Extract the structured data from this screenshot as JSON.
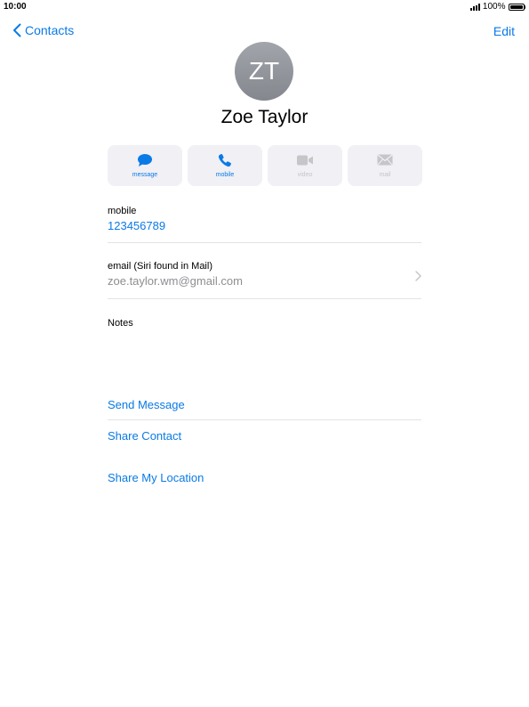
{
  "status": {
    "time": "10:00",
    "battery": "100%",
    "battery_level": 1.0
  },
  "nav": {
    "back_label": "Contacts",
    "edit_label": "Edit"
  },
  "contact": {
    "initials": "ZT",
    "name": "Zoe Taylor"
  },
  "actions": [
    {
      "label": "message",
      "icon": "message-bubble-icon",
      "enabled": true
    },
    {
      "label": "mobile",
      "icon": "phone-icon",
      "enabled": true
    },
    {
      "label": "video",
      "icon": "video-camera-icon",
      "enabled": false
    },
    {
      "label": "mail",
      "icon": "envelope-icon",
      "enabled": false
    }
  ],
  "fields": {
    "mobile": {
      "label": "mobile",
      "value": "123456789"
    },
    "email": {
      "label": "email (Siri found in Mail)",
      "value": "zoe.taylor.wm@gmail.com"
    },
    "notes": {
      "label": "Notes"
    }
  },
  "links": {
    "send_message": "Send Message",
    "share_contact": "Share Contact",
    "share_location": "Share My Location"
  },
  "colors": {
    "accent": "#0a7ae6",
    "disabled": "#c6c6c9",
    "secondary_text": "#8e8e93"
  }
}
